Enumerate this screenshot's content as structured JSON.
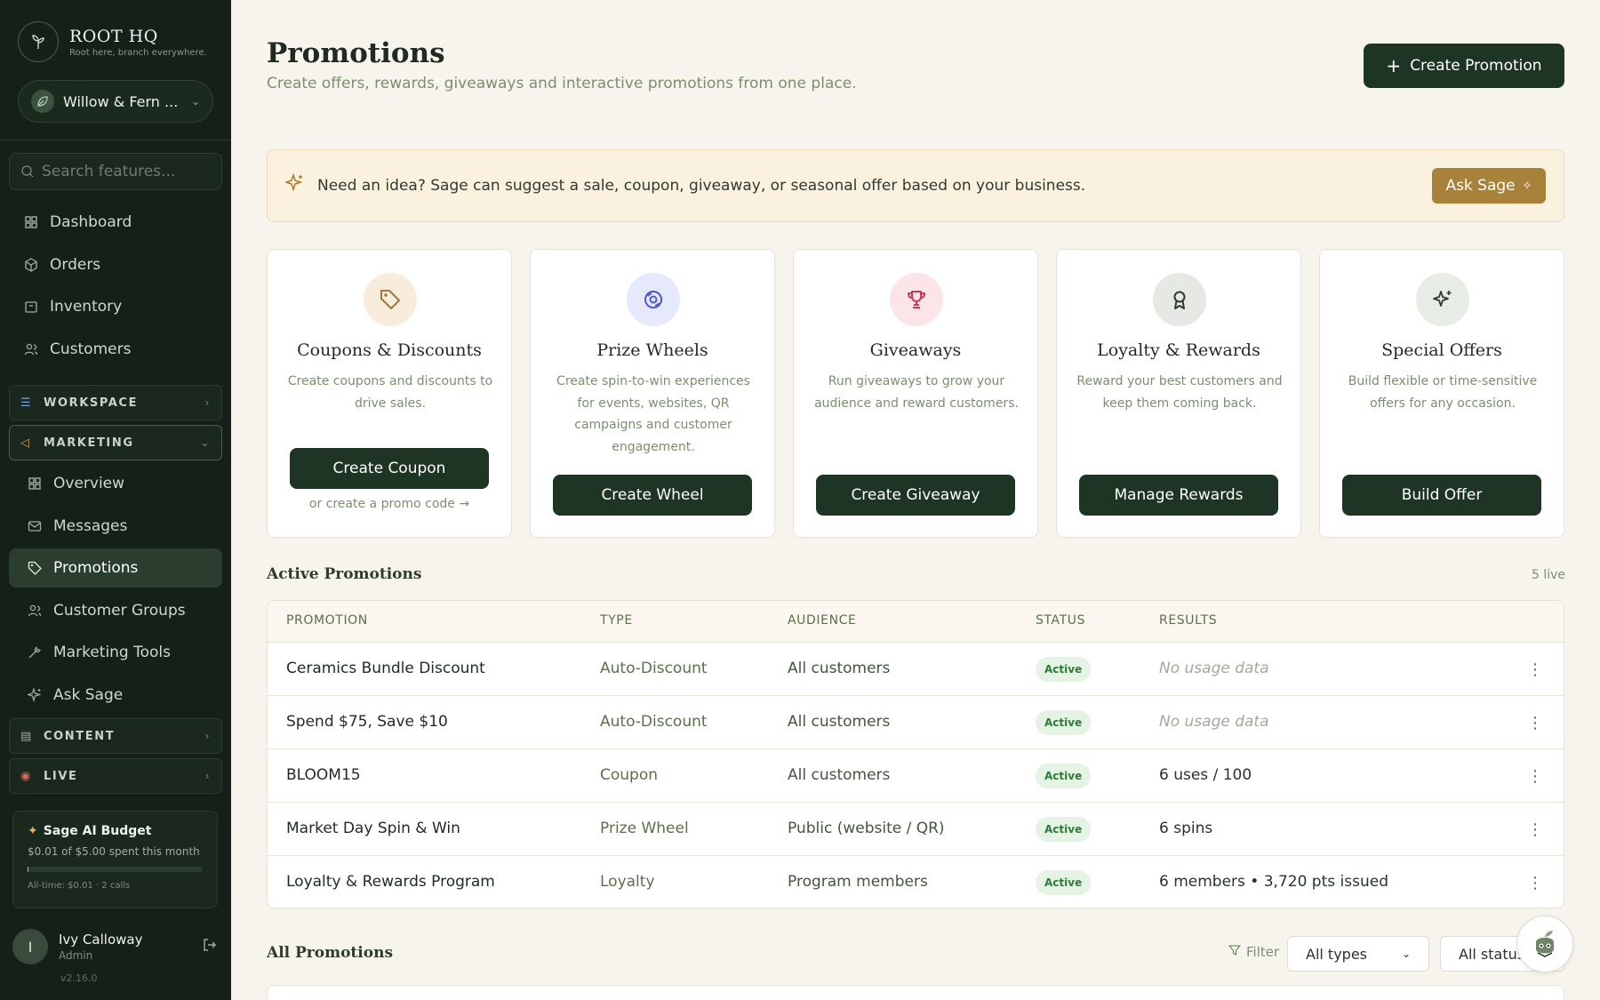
{
  "brand": {
    "name": "ROOT HQ",
    "tagline": "Root here, branch everywhere."
  },
  "store": {
    "name": "Willow & Fern ..."
  },
  "search": {
    "placeholder": "Search features..."
  },
  "nav_top": [
    {
      "label": "Dashboard",
      "icon": "dashboard-icon"
    },
    {
      "label": "Orders",
      "icon": "box-icon"
    },
    {
      "label": "Inventory",
      "icon": "inventory-icon"
    },
    {
      "label": "Customers",
      "icon": "users-icon"
    }
  ],
  "sections": {
    "workspace": "WORKSPACE",
    "marketing": "MARKETING",
    "content": "CONTENT",
    "live": "LIVE"
  },
  "nav_marketing": [
    {
      "label": "Overview",
      "icon": "grid-icon"
    },
    {
      "label": "Messages",
      "icon": "mail-icon"
    },
    {
      "label": "Promotions",
      "icon": "tag-icon",
      "active": true
    },
    {
      "label": "Customer Groups",
      "icon": "users-icon"
    },
    {
      "label": "Marketing Tools",
      "icon": "wrench-icon"
    },
    {
      "label": "Ask Sage",
      "icon": "sparkle-icon"
    }
  ],
  "budget": {
    "title": "Sage AI Budget",
    "spent": "$0.01 of $5.00 spent this month",
    "spent_fraction": 0.002,
    "all_time": "All-time: $0.01 · 2 calls"
  },
  "user": {
    "initial": "I",
    "name": "Ivy Calloway",
    "role": "Admin",
    "version": "v2.16.0"
  },
  "header": {
    "title": "Promotions",
    "subtitle": "Create offers, rewards, giveaways and interactive promotions from one place.",
    "create_label": "Create Promotion"
  },
  "idea": {
    "text": "Need an idea? Sage can suggest a sale, coupon, giveaway, or seasonal offer based on your business.",
    "button": "Ask Sage"
  },
  "cards": [
    {
      "title": "Coupons & Discounts",
      "desc": "Create coupons and discounts to drive sales.",
      "button": "Create Coupon",
      "link": "or create a promo code →",
      "icon": "tag-icon",
      "bg": "#f8ecdd",
      "fg": "#a0763a"
    },
    {
      "title": "Prize Wheels",
      "desc": "Create spin-to-win experiences for events, websites, QR campaigns and customer engagement.",
      "button": "Create Wheel",
      "icon": "wheel-icon",
      "bg": "#e6e8fb",
      "fg": "#4f57c9"
    },
    {
      "title": "Giveaways",
      "desc": "Run giveaways to grow your audience and reward customers.",
      "button": "Create Giveaway",
      "icon": "trophy-icon",
      "bg": "#fce5e8",
      "fg": "#c93a55"
    },
    {
      "title": "Loyalty & Rewards",
      "desc": "Reward your best customers and keep them coming back.",
      "button": "Manage Rewards",
      "icon": "award-icon",
      "bg": "#e5e8e3",
      "fg": "#2c3a2f"
    },
    {
      "title": "Special Offers",
      "desc": "Build flexible or time-sensitive offers for any occasion.",
      "button": "Build Offer",
      "icon": "sparkle-icon",
      "bg": "#e7ece5",
      "fg": "#2c3a2f"
    }
  ],
  "active": {
    "title": "Active Promotions",
    "count": "5 live",
    "columns": [
      "PROMOTION",
      "TYPE",
      "AUDIENCE",
      "STATUS",
      "RESULTS"
    ],
    "rows": [
      {
        "name": "Ceramics Bundle Discount",
        "type": "Auto-Discount",
        "audience": "All customers",
        "status": "Active",
        "results": "No usage data",
        "muted": true
      },
      {
        "name": "Spend $75, Save $10",
        "type": "Auto-Discount",
        "audience": "All customers",
        "status": "Active",
        "results": "No usage data",
        "muted": true
      },
      {
        "name": "BLOOM15",
        "type": "Coupon",
        "audience": "All customers",
        "status": "Active",
        "results": "6 uses / 100",
        "muted": false
      },
      {
        "name": "Market Day Spin & Win",
        "type": "Prize Wheel",
        "audience": "Public (website / QR)",
        "status": "Active",
        "results": "6 spins",
        "muted": false
      },
      {
        "name": "Loyalty & Rewards Program",
        "type": "Loyalty",
        "audience": "Program members",
        "status": "Active",
        "results": "6 members • 3,720 pts issued",
        "muted": false
      }
    ]
  },
  "all": {
    "title": "All Promotions",
    "filter": "Filter",
    "type_select": "All types",
    "status_select": "All status"
  }
}
